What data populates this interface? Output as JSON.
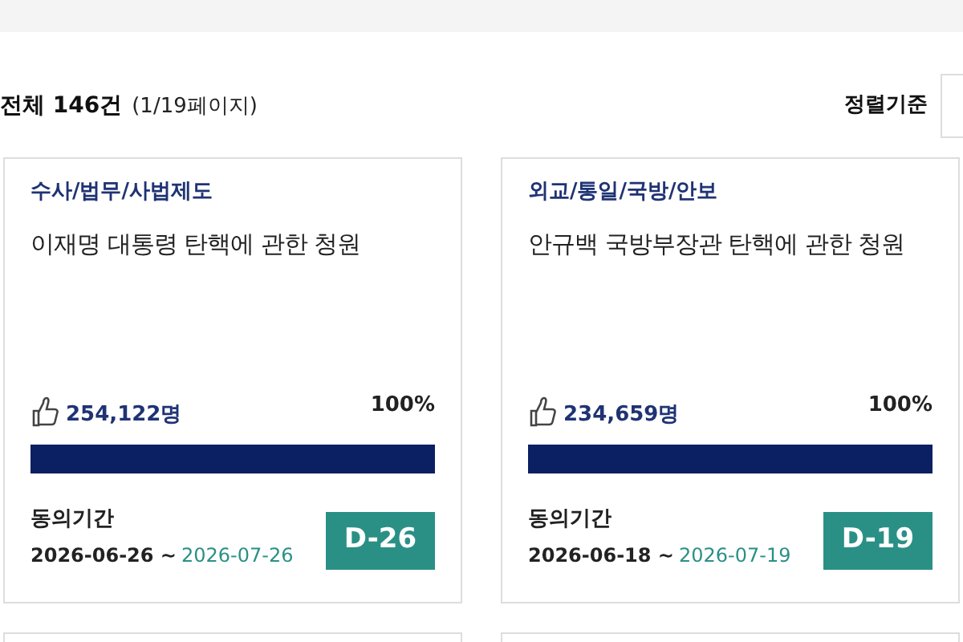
{
  "summary": {
    "total": "전체 146건",
    "pages": "(1/19페이지)"
  },
  "sort": {
    "label": "정렬기준"
  },
  "petitions": [
    {
      "category": "수사/법무/사법제도",
      "title": "이재명 대통령 탄핵에 관한 청원",
      "count": "254,122명",
      "percent": "100%",
      "level": 1,
      "period_label": "동의기간",
      "start": "2026-06-26 ~",
      "end": "2026-07-26",
      "dday": "D-26"
    },
    {
      "category": "외교/통일/국방/안보",
      "title": "안규백 국방부장관 탄핵에 관한 청원",
      "count": "234,659명",
      "percent": "100%",
      "level": 1,
      "period_label": "동의기간",
      "start": "2026-06-18 ~",
      "end": "2026-07-19",
      "dday": "D-19"
    }
  ]
}
